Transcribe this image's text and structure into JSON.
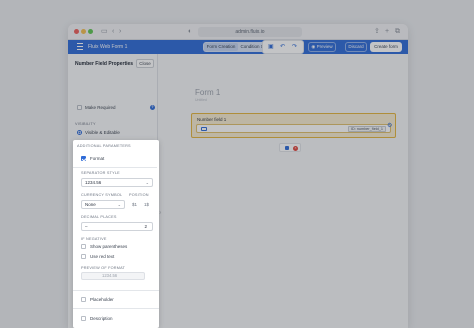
{
  "browser": {
    "url": "admin.fluix.io"
  },
  "app": {
    "title": "Fluix Web Form 1"
  },
  "header": {
    "tabs": [
      "Form Creation",
      "Condition Setup"
    ],
    "preview_label": "Preview",
    "discard_label": "Discard",
    "create_label": "Create form"
  },
  "panel": {
    "title": "Number Field Properties",
    "close_label": "Close",
    "make_required": "Make Required",
    "visibility_heading": "VISIBILITY",
    "visibility_options": [
      "Visible & Editable",
      "Read Only",
      "Hidden"
    ],
    "selected_visibility": "Visible & Editable"
  },
  "additional": {
    "heading": "ADDITIONAL PARAMETERS",
    "format_label": "Format",
    "separator_heading": "SEPARATOR STYLE",
    "separator_value": "1234.56",
    "currency_heading": "CURRENCY SYMBOL",
    "position_heading": "POSITION",
    "currency_value": "None",
    "position_options": [
      "$1",
      "1$"
    ],
    "decimal_heading": "DECIMAL PLACES",
    "decimal_minus": "–",
    "decimal_value": "2",
    "negative_heading": "IF NEGATIVE",
    "negative_options": [
      "Show parentheses",
      "Use red text"
    ],
    "preview_heading": "PREVIEW OF FORMAT",
    "preview_value": "1234.56",
    "placeholder_label": "Placeholder",
    "description_label": "Description"
  },
  "canvas": {
    "form_title": "Form 1",
    "form_subtitle": "Untitled",
    "field_label": "Number field 1",
    "field_tag": "ID: number_field_1"
  }
}
